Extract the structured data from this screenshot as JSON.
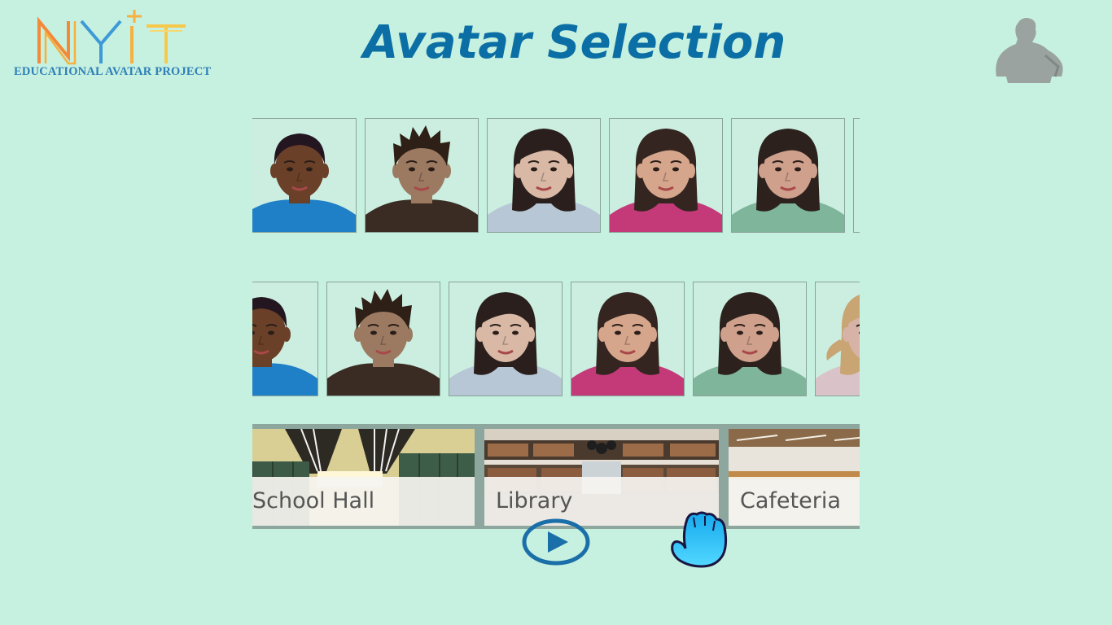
{
  "logo": {
    "wordmark": "NYIT",
    "subtitle": "EDUCATIONAL AVATAR PROJECT"
  },
  "page": {
    "title": "Avatar Selection"
  },
  "avatars_row1": [
    {
      "name": "boy-dark-blue-shirt",
      "skin": "#6b4028",
      "hair": "#241620",
      "shirt": "#1f7fc7"
    },
    {
      "name": "boy-spiky-brown-shirt",
      "skin": "#9c7a62",
      "hair": "#2e2016",
      "shirt": "#3a2c22"
    },
    {
      "name": "girl-light-top",
      "skin": "#d9b9a6",
      "hair": "#2a1f1c",
      "shirt": "#b7c7d5"
    },
    {
      "name": "girl-pink-top",
      "skin": "#d5a68c",
      "hair": "#352520",
      "shirt": "#c43a79"
    },
    {
      "name": "girl-green-top",
      "skin": "#cfa08c",
      "hair": "#2c211d",
      "shirt": "#7fb59a"
    }
  ],
  "avatars_row2": [
    {
      "name": "boy-dark-blue-shirt",
      "skin": "#6b4028",
      "hair": "#241620",
      "shirt": "#1f7fc7"
    },
    {
      "name": "boy-spiky-brown-shirt",
      "skin": "#9c7a62",
      "hair": "#2e2016",
      "shirt": "#3a2c22"
    },
    {
      "name": "girl-light-top",
      "skin": "#d9b9a6",
      "hair": "#2a1f1c",
      "shirt": "#b7c7d5"
    },
    {
      "name": "girl-pink-top",
      "skin": "#d5a68c",
      "hair": "#352520",
      "shirt": "#c43a79"
    },
    {
      "name": "girl-green-top",
      "skin": "#cfa08c",
      "hair": "#2c211d",
      "shirt": "#7fb59a"
    },
    {
      "name": "girl-blonde-ponytail",
      "skin": "#d6b3a6",
      "hair": "#c9a574",
      "shirt": "#d9c3c9"
    }
  ],
  "scenes": [
    {
      "label": "School Hall"
    },
    {
      "label": "Library"
    },
    {
      "label": "Cafeteria"
    }
  ],
  "colors": {
    "background": "#c6f0df",
    "title": "#0b6fa5",
    "play_ring": "#1a6fa8",
    "hand": "#33c4f7"
  }
}
